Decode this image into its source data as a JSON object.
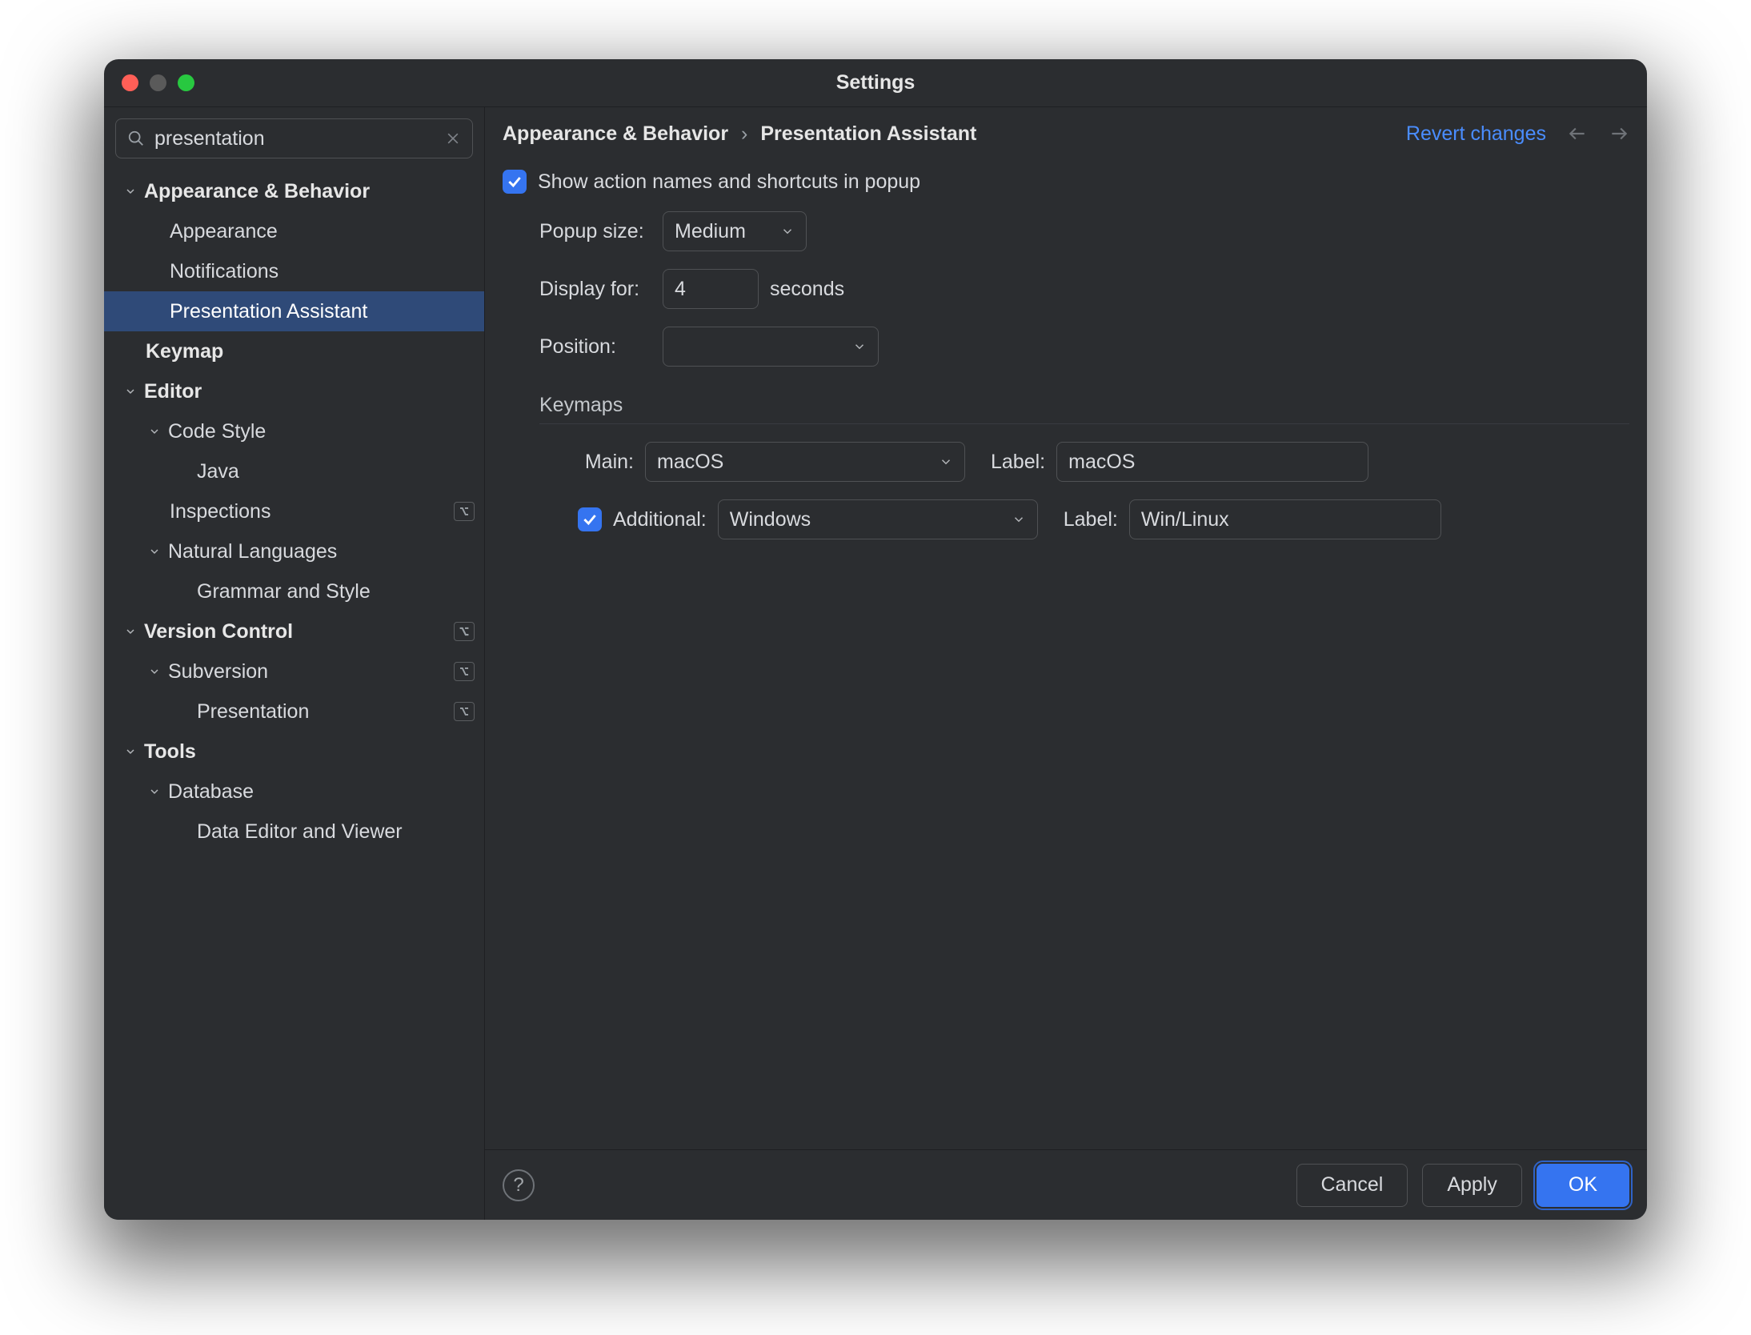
{
  "window": {
    "title": "Settings"
  },
  "search": {
    "value": "presentation"
  },
  "tree": [
    {
      "label": "Appearance & Behavior",
      "depth": 0,
      "expanded": true,
      "bold": true
    },
    {
      "label": "Appearance",
      "depth": 1
    },
    {
      "label": "Notifications",
      "depth": 1
    },
    {
      "label": "Presentation Assistant",
      "depth": 1,
      "selected": true
    },
    {
      "label": "Keymap",
      "depth": 0,
      "bold": true,
      "noChevron": true,
      "padAsD1Label": true
    },
    {
      "label": "Editor",
      "depth": 0,
      "expanded": true,
      "bold": true
    },
    {
      "label": "Code Style",
      "depth": 1,
      "expanded": true
    },
    {
      "label": "Java",
      "depth": 2
    },
    {
      "label": "Inspections",
      "depth": 1,
      "badge": "⌥"
    },
    {
      "label": "Natural Languages",
      "depth": 1,
      "expanded": true
    },
    {
      "label": "Grammar and Style",
      "depth": 2
    },
    {
      "label": "Version Control",
      "depth": 0,
      "expanded": true,
      "bold": true,
      "badge": "⌥"
    },
    {
      "label": "Subversion",
      "depth": 1,
      "expanded": true,
      "badge": "⌥"
    },
    {
      "label": "Presentation",
      "depth": 2,
      "badge": "⌥"
    },
    {
      "label": "Tools",
      "depth": 0,
      "expanded": true,
      "bold": true
    },
    {
      "label": "Database",
      "depth": 1,
      "expanded": true
    },
    {
      "label": "Data Editor and Viewer",
      "depth": 2
    }
  ],
  "header": {
    "crumb1": "Appearance & Behavior",
    "crumb2": "Presentation Assistant",
    "revert": "Revert changes"
  },
  "form": {
    "show_label": "Show action names and shortcuts in popup",
    "popup_size_label": "Popup size:",
    "popup_size_value": "Medium",
    "display_for_label": "Display for:",
    "display_for_value": "4",
    "display_for_suffix": "seconds",
    "position_label": "Position:",
    "position_value": "",
    "keymaps_label": "Keymaps",
    "main_label": "Main:",
    "main_value": "macOS",
    "main_label2": "Label:",
    "main_label2_value": "macOS",
    "additional_label": "Additional:",
    "additional_value": "Windows",
    "additional_label2": "Label:",
    "additional_label2_value": "Win/Linux"
  },
  "footer": {
    "cancel": "Cancel",
    "apply": "Apply",
    "ok": "OK"
  }
}
